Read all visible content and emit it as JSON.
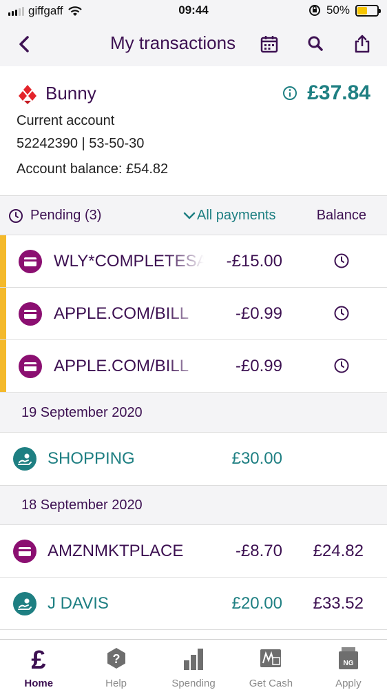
{
  "status_bar": {
    "carrier": "giffgaff",
    "time": "09:44",
    "battery_percent": "50%",
    "battery_level": 0.5
  },
  "header": {
    "title": "My transactions"
  },
  "account": {
    "name": "Bunny",
    "available_amount": "£37.84",
    "type": "Current account",
    "numbers": "52242390 | 53-50-30",
    "balance_text": "Account balance: £54.82"
  },
  "filters": {
    "pending_label": "Pending (3)",
    "all_payments_label": "All payments",
    "balance_label": "Balance"
  },
  "pending": [
    {
      "name": "WLY*COMPLETESA",
      "amount": "-£15.00"
    },
    {
      "name": "APPLE.COM/BILL",
      "amount": "-£0.99"
    },
    {
      "name": "APPLE.COM/BILL",
      "amount": "-£0.99"
    }
  ],
  "groups": [
    {
      "date": "19 September 2020",
      "items": [
        {
          "name": "SHOPPING",
          "amount": "£30.00",
          "balance": ""
        }
      ]
    },
    {
      "date": "18 September 2020",
      "items": [
        {
          "name": "AMZNMKTPLACE",
          "amount": "-£8.70",
          "balance": "£24.82"
        },
        {
          "name": "J DAVIS",
          "amount": "£20.00",
          "balance": "£33.52"
        }
      ]
    }
  ],
  "tabs": [
    {
      "label": "Home",
      "icon": "pound-icon"
    },
    {
      "label": "Help",
      "icon": "help-icon"
    },
    {
      "label": "Spending",
      "icon": "bar-chart-icon"
    },
    {
      "label": "Get Cash",
      "icon": "get-cash-icon"
    },
    {
      "label": "Apply",
      "icon": "apply-icon"
    }
  ],
  "colors": {
    "brand_purple": "#3d1152",
    "teal": "#1e7f82",
    "card_magenta": "#8b0f71",
    "pending_marker": "#f4b92b"
  }
}
